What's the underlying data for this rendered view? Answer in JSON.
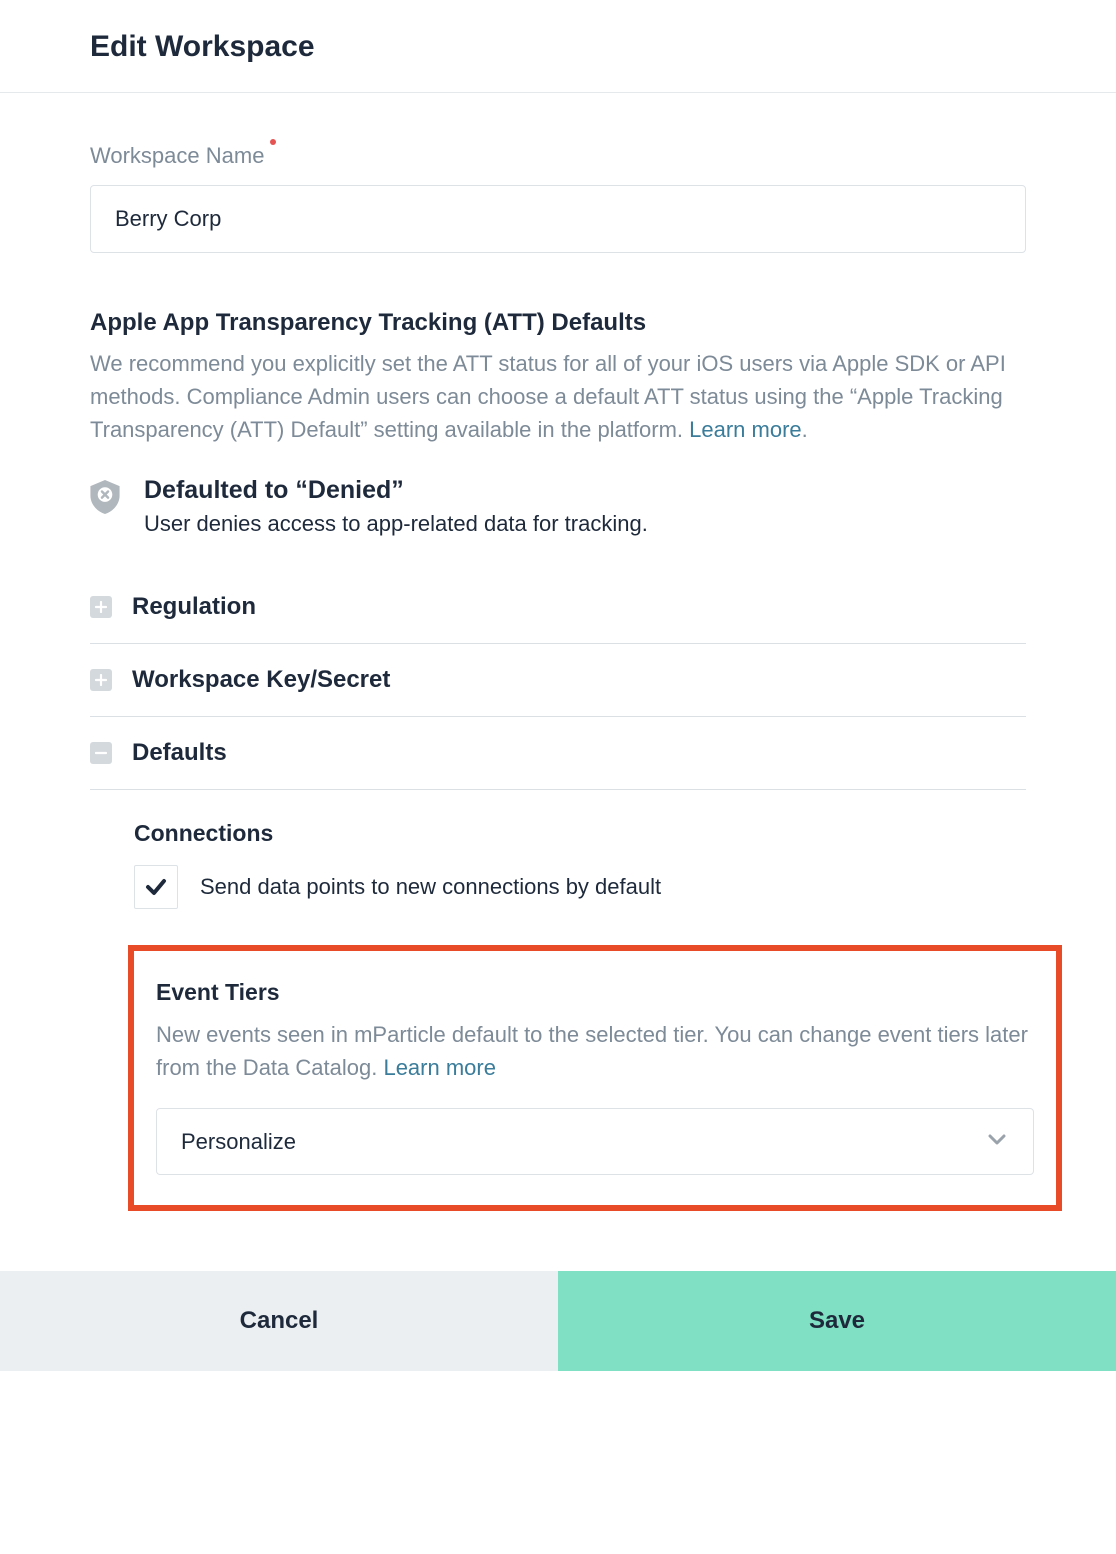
{
  "header": {
    "title": "Edit Workspace"
  },
  "workspace_name": {
    "label": "Workspace Name",
    "value": "Berry Corp"
  },
  "att": {
    "title": "Apple App Transparency Tracking (ATT) Defaults",
    "description": "We recommend you explicitly set the ATT status for all of your iOS users via Apple SDK or API methods. Compliance Admin users can choose a default ATT status using the “Apple Tracking Transparency (ATT) Default” setting available in the platform. ",
    "learn_more": "Learn more",
    "default_title": "Defaulted to “Denied”",
    "default_sub": "User denies access to app-related data for tracking."
  },
  "accordion": {
    "regulation": "Regulation",
    "key_secret": "Workspace Key/Secret",
    "defaults": "Defaults"
  },
  "connections": {
    "heading": "Connections",
    "checkbox_label": "Send data points to new connections by default",
    "checked": true
  },
  "event_tiers": {
    "heading": "Event Tiers",
    "description": "New events seen in mParticle default to the selected tier. You can change event tiers later from the Data Catalog. ",
    "learn_more": "Learn more",
    "selected": "Personalize"
  },
  "footer": {
    "cancel": "Cancel",
    "save": "Save"
  }
}
